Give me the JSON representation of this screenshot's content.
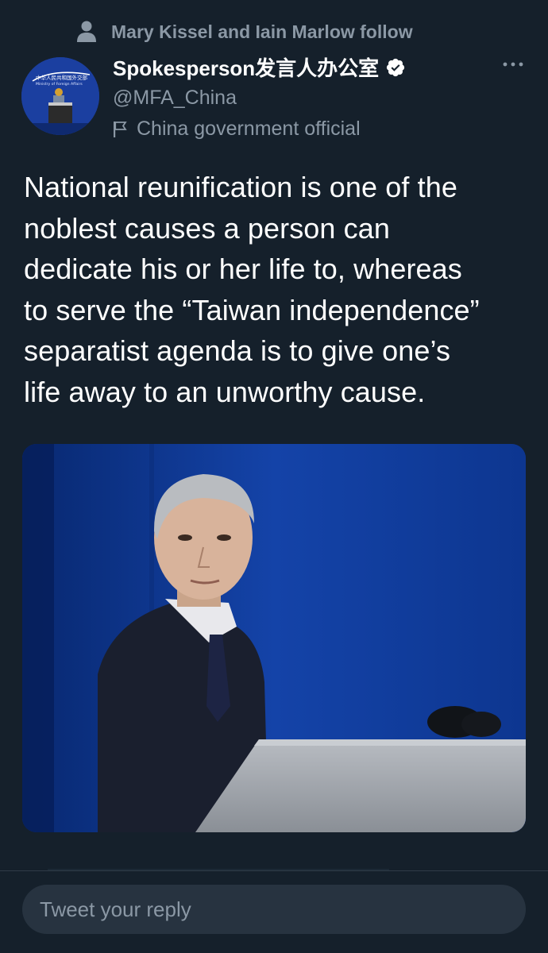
{
  "social_context": {
    "text": "Mary Kissel and Iain Marlow follow"
  },
  "author": {
    "display_name": "Spokesperson发言人办公室",
    "handle": "@MFA_China",
    "label": "China government official",
    "avatar_text_cn": "中华人民共和国外交部",
    "avatar_text_en": "Ministry of Foreign Affairs"
  },
  "tweet": {
    "lines": [
      "National reunification is one of the",
      "noblest causes a person can",
      "dedicate his or her life to, whereas",
      "to serve the “Taiwan independence”",
      "separatist agenda is to give one’s",
      "life away to an unworthy cause."
    ]
  },
  "reply": {
    "placeholder": "Tweet your reply"
  },
  "colors": {
    "background": "#15202b",
    "secondary_text": "#8b98a5",
    "verified_badge": "#ffffff",
    "reply_box": "#273340",
    "media_backdrop": "#0c2f8a"
  },
  "icons": {
    "social": "person-icon",
    "verified": "verified-badge-icon",
    "label": "flag-icon",
    "more": "more-dots-icon"
  }
}
